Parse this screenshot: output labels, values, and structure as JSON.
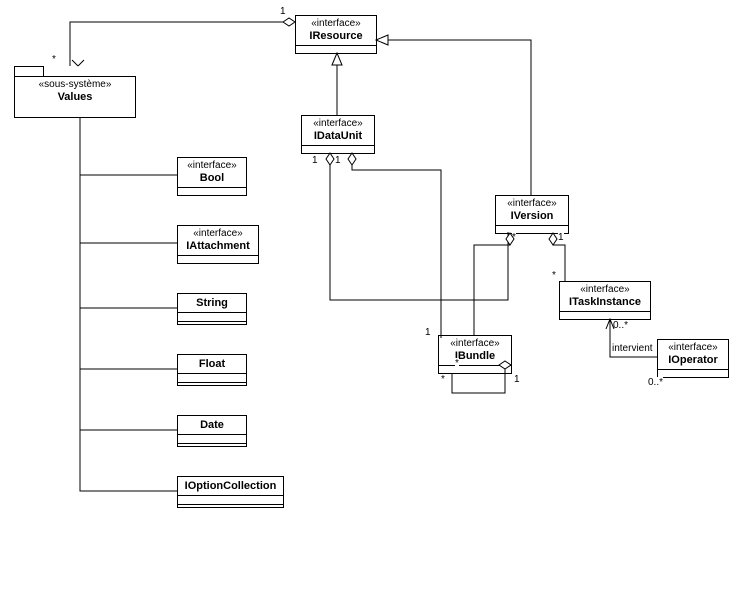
{
  "values": {
    "stereo": "«sous-système»",
    "name": "Values"
  },
  "iresource": {
    "stereo": "«interface»",
    "name": "IResource"
  },
  "idataunit": {
    "stereo": "«interface»",
    "name": "IDataUnit"
  },
  "iversion": {
    "stereo": "«interface»",
    "name": "IVersion"
  },
  "itask": {
    "stereo": "«interface»",
    "name": "ITaskInstance"
  },
  "ibundle": {
    "stereo": "«interface»",
    "name": "IBundle"
  },
  "ioperator": {
    "stereo": "«interface»",
    "name": "IOperator"
  },
  "bool": {
    "stereo": "«interface»",
    "name": "Bool"
  },
  "iattachment": {
    "stereo": "«interface»",
    "name": "IAttachment"
  },
  "string": {
    "name": "String"
  },
  "float": {
    "name": "Float"
  },
  "date": {
    "name": "Date"
  },
  "iopt": {
    "name": "IOptionCollection"
  },
  "mult": {
    "one": "1",
    "star": "*",
    "zeroStar": "0..*"
  },
  "rel": {
    "intervient": "intervient"
  },
  "chart_data": {
    "type": "uml-class-diagram",
    "classes": [
      {
        "name": "Values",
        "stereotype": "sous-système"
      },
      {
        "name": "IResource",
        "stereotype": "interface"
      },
      {
        "name": "IDataUnit",
        "stereotype": "interface"
      },
      {
        "name": "IVersion",
        "stereotype": "interface"
      },
      {
        "name": "ITaskInstance",
        "stereotype": "interface"
      },
      {
        "name": "IBundle",
        "stereotype": "interface"
      },
      {
        "name": "IOperator",
        "stereotype": "interface"
      },
      {
        "name": "Bool",
        "stereotype": "interface"
      },
      {
        "name": "IAttachment",
        "stereotype": "interface"
      },
      {
        "name": "String"
      },
      {
        "name": "Float"
      },
      {
        "name": "Date"
      },
      {
        "name": "IOptionCollection"
      }
    ],
    "relations": [
      {
        "from": "IResource",
        "to": "Values",
        "type": "aggregation",
        "mult": {
          "from": "1",
          "to": "*"
        }
      },
      {
        "from": "IDataUnit",
        "to": "IResource",
        "type": "generalization"
      },
      {
        "from": "IVersion",
        "to": "IResource",
        "type": "generalization"
      },
      {
        "from": "IDataUnit",
        "to": "IVersion",
        "type": "aggregation",
        "mult": {
          "from": "1",
          "to": "*"
        }
      },
      {
        "from": "IDataUnit",
        "to": "IBundle",
        "type": "aggregation",
        "mult": {
          "from": "1",
          "to": "1"
        }
      },
      {
        "from": "IVersion",
        "to": "IBundle",
        "type": "aggregation",
        "mult": {
          "to": "*"
        }
      },
      {
        "from": "IVersion",
        "to": "ITaskInstance",
        "type": "aggregation",
        "mult": {
          "from": "1",
          "to": "*"
        }
      },
      {
        "from": "IBundle",
        "to": "IBundle",
        "type": "aggregation",
        "self": true,
        "mult": {
          "from": "*",
          "to": "1"
        }
      },
      {
        "from": "ITaskInstance",
        "to": "IOperator",
        "type": "association",
        "label": "intervient",
        "mult": {
          "from": "0..*",
          "to": "0..*"
        }
      },
      {
        "from": "Values",
        "to": "Bool",
        "type": "containment"
      },
      {
        "from": "Values",
        "to": "IAttachment",
        "type": "containment"
      },
      {
        "from": "Values",
        "to": "String",
        "type": "containment"
      },
      {
        "from": "Values",
        "to": "Float",
        "type": "containment"
      },
      {
        "from": "Values",
        "to": "Date",
        "type": "containment"
      },
      {
        "from": "Values",
        "to": "IOptionCollection",
        "type": "containment"
      }
    ]
  }
}
